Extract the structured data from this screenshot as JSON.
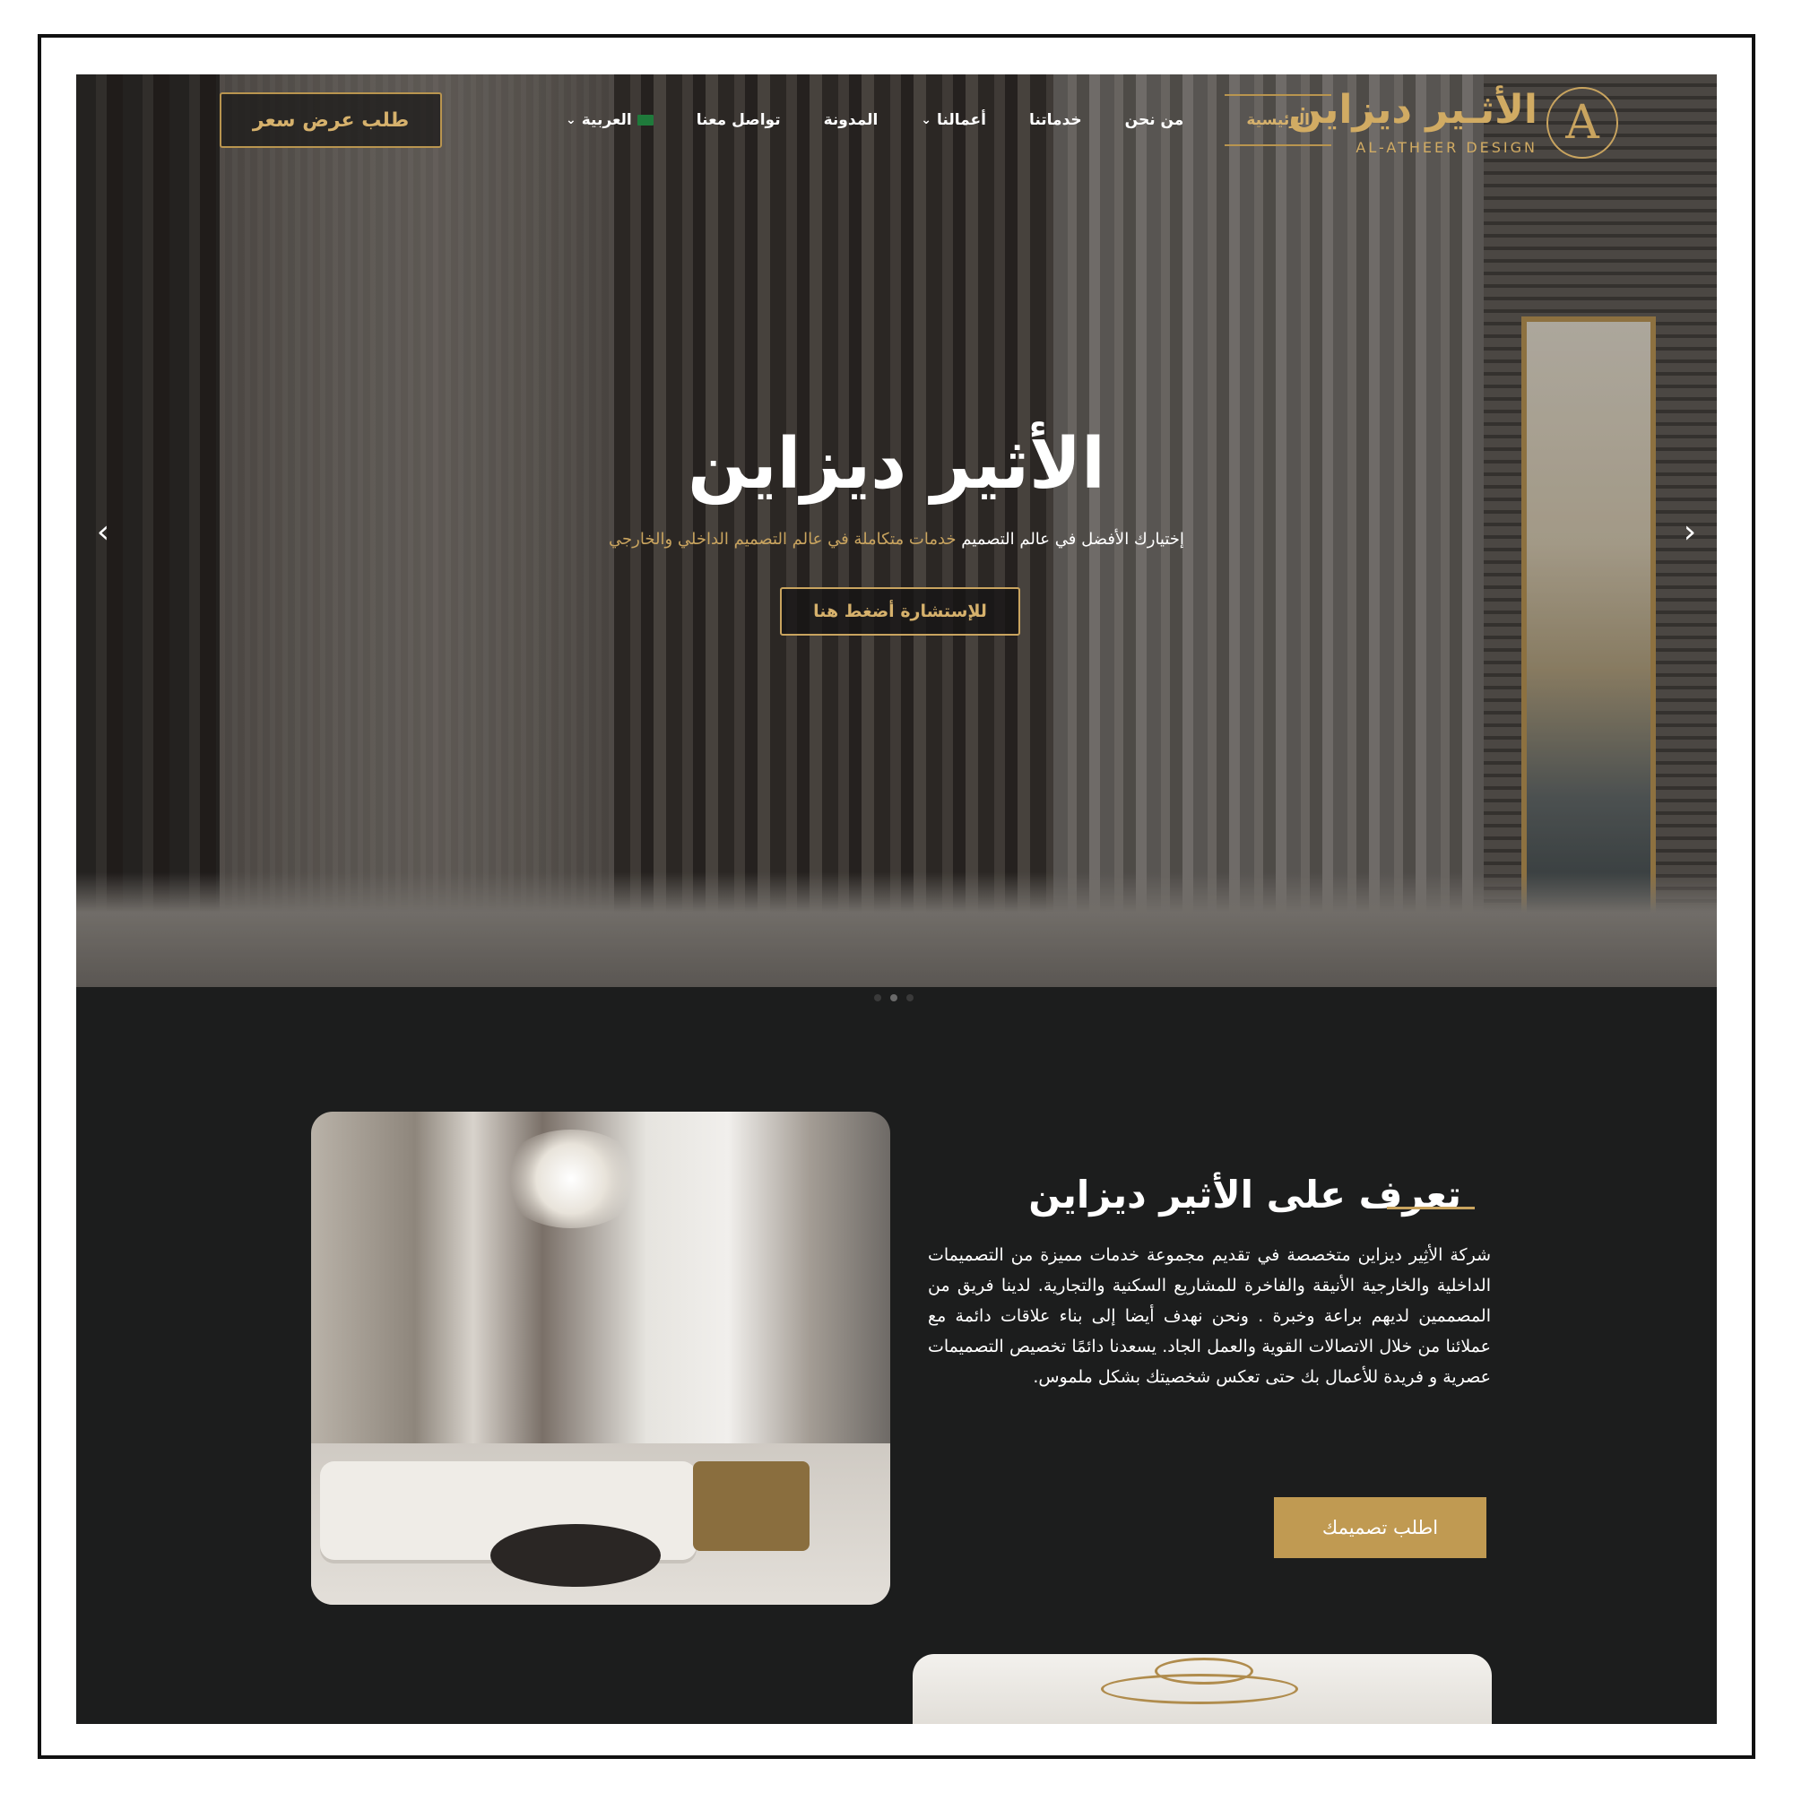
{
  "colors": {
    "gold": "#c9a45f",
    "dark": "#1c1d1d",
    "white": "#ffffff"
  },
  "header": {
    "quote_button": "طلب عرض سعر",
    "nav": [
      {
        "label": "الرئيسية",
        "active": true
      },
      {
        "label": "من نحن"
      },
      {
        "label": "خدماتنا"
      },
      {
        "label": "أعمالنا",
        "icon": "chevron-down-icon"
      },
      {
        "label": "المدونة"
      },
      {
        "label": "تواصل معنا"
      },
      {
        "label": "العربية",
        "icon": "chevron-down-icon",
        "flag": "saudi-flag-icon"
      }
    ],
    "logo": {
      "arabic": "الأثـير ديزاين",
      "english": "AL-ATHEER DESIGN",
      "mark": "A"
    }
  },
  "hero": {
    "title": "الأثير ديزاين",
    "subtitle_white": "إختيارك الأفضل في عالم التصميم",
    "subtitle_gold": "خدمات متكاملة في عالم التصميم الداخلي والخارجي",
    "cta": "للإستشارة أضغط هنا",
    "prev_icon": "chevron-left-icon",
    "next_icon": "chevron-right-icon",
    "slide_count": 3,
    "active_slide": 2
  },
  "about": {
    "title": "تعرف على الأثير ديزاين",
    "text": "شركة الأثِير ديزاين متخصصة في تقديم مجموعة خدمات مميزة من التصميمات الداخلية والخارجية الأنيقة والفاخرة للمشاريع السكنية والتجارية. لدينا فريق من المصممين لديهم براعة وخبرة . ونحن نهدف أيضا إلى بناء علاقات دائمة مع عملائنا من خلال الاتصالات القوية والعمل الجاد. يسعدنا دائمًا تخصيص التصميمات عصرية و فريدة للأعمال بك حتى تعكس شخصيتك بشكل ملموس.",
    "button": "اطلب تصميمك"
  }
}
